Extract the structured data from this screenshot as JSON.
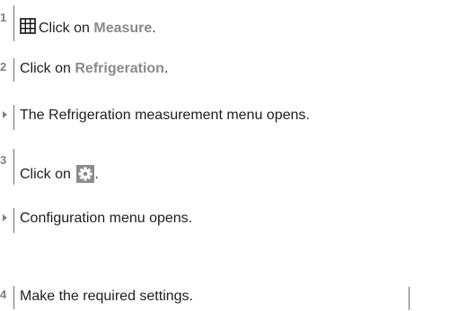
{
  "steps": [
    {
      "marker": "1",
      "prefix": "Click on ",
      "target": "Measure",
      "suffix": ".",
      "icon": "grid-icon"
    },
    {
      "marker": "2",
      "prefix": "Click on ",
      "target": "Refrigeration",
      "suffix": "."
    },
    {
      "marker": "result-arrow",
      "text": "The Refrigeration measurement menu opens."
    },
    {
      "marker": "3",
      "prefix": "Click on ",
      "suffix": ".",
      "icon": "gear-icon"
    },
    {
      "marker": "result-arrow",
      "text": "Configuration menu opens."
    },
    {
      "marker": "4",
      "text": "Make the required settings."
    }
  ],
  "colors": {
    "text": "#1e1e1e",
    "ui_element": "#8a8a8a",
    "marker": "#7f7f7f",
    "icon_fill": "#8c8c8c"
  }
}
